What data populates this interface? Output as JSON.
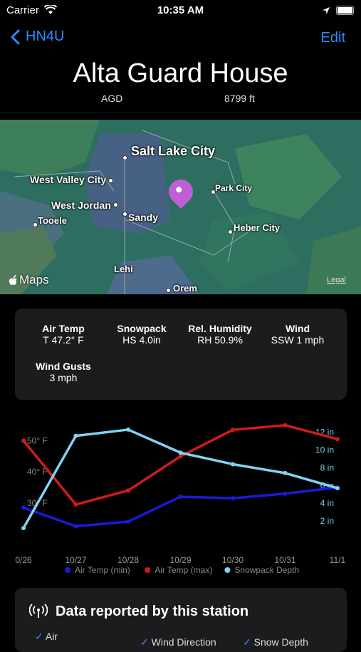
{
  "status": {
    "carrier": "Carrier",
    "time": "10:35 AM"
  },
  "nav": {
    "back_label": "HN4U",
    "edit_label": "Edit"
  },
  "station": {
    "name": "Alta Guard House",
    "code": "AGD",
    "elevation": "8799 ft"
  },
  "map": {
    "labels": [
      "Salt Lake City",
      "West Valley City",
      "Park City",
      "West Jordan",
      "Sandy",
      "Tooele",
      "Heber City",
      "Lehi",
      "Orem"
    ],
    "brand": "Maps",
    "legal": "Legal"
  },
  "observations": [
    {
      "label": "Air Temp",
      "value": "T 47.2° F"
    },
    {
      "label": "Snowpack",
      "value": "HS 4.0in"
    },
    {
      "label": "Rel. Humidity",
      "value": "RH 50.9%"
    },
    {
      "label": "Wind",
      "value": "SSW 1 mph"
    },
    {
      "label": "Wind Gusts",
      "value": "3 mph"
    }
  ],
  "chart_data": {
    "type": "line",
    "categories": [
      "0/26",
      "10/27",
      "10/28",
      "10/29",
      "10/30",
      "10/31",
      "11/1"
    ],
    "series": [
      {
        "name": "Air Temp (min)",
        "axis": "left",
        "color": "#1a1ad6",
        "values": [
          28.5,
          22.5,
          24,
          32,
          31.5,
          33,
          35
        ]
      },
      {
        "name": "Air Temp (max)",
        "axis": "left",
        "color": "#d11a1a",
        "values": [
          50,
          29.5,
          34,
          45,
          53.5,
          55,
          50.5
        ]
      },
      {
        "name": "Snowpack Depth",
        "axis": "right",
        "color": "#7fd3f5",
        "values": [
          1.2,
          11.6,
          12.3,
          9.7,
          8.4,
          7.4,
          5.7
        ]
      }
    ],
    "left_ticks": [
      "50° F",
      "40° F",
      "30° F"
    ],
    "left_tick_values": [
      50,
      40,
      30
    ],
    "right_ticks": [
      "12 in",
      "10 in",
      "8 in",
      "6 in",
      "4 in",
      "2 in"
    ],
    "right_tick_values": [
      12,
      10,
      8,
      6,
      4,
      2
    ],
    "ylim_left": [
      18.5,
      57
    ],
    "ylim_right": [
      0,
      13.5
    ]
  },
  "reported": {
    "title": "Data reported by this station",
    "items": [
      "Air",
      "Wind Direction",
      "Snow Depth"
    ]
  }
}
